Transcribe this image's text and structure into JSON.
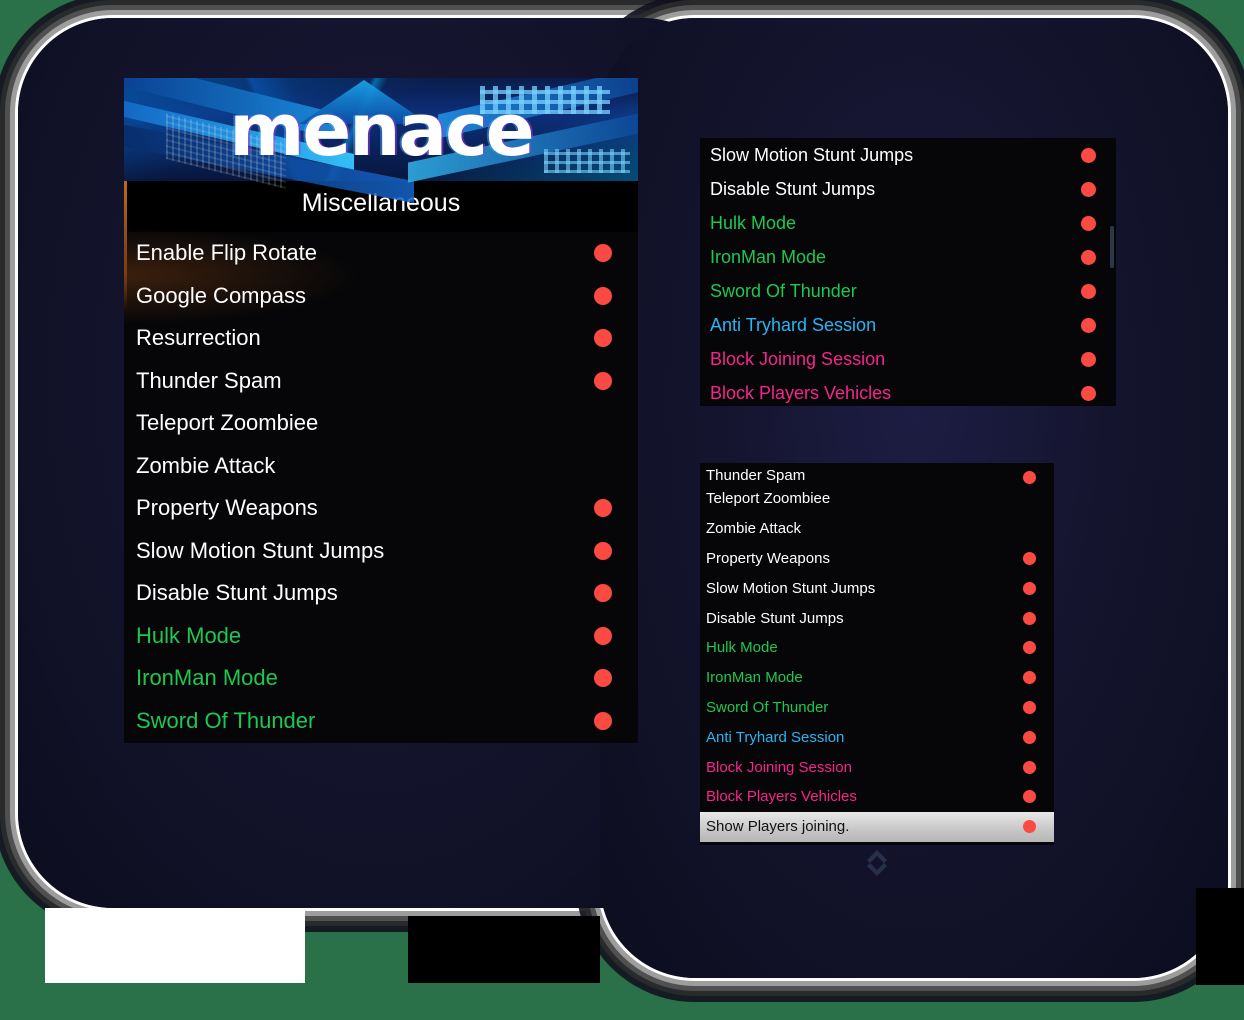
{
  "app": {
    "logo_text": "menace",
    "section_title": "Miscellaneous",
    "accent_red": "#fa4a42",
    "accent_green": "#1ec850",
    "accent_cyan": "#2ab4f5",
    "accent_pink": "#f5258c",
    "page_background": "#2a7049",
    "panel_background": "#060608"
  },
  "main_panel": {
    "items": [
      {
        "label": "Enable Flip Rotate",
        "color": "#ffffff",
        "toggle": true
      },
      {
        "label": "Google Compass",
        "color": "#ffffff",
        "toggle": true
      },
      {
        "label": "Resurrection",
        "color": "#ffffff",
        "toggle": true
      },
      {
        "label": "Thunder Spam",
        "color": "#ffffff",
        "toggle": true
      },
      {
        "label": "Teleport Zoombiee",
        "color": "#ffffff",
        "toggle": false
      },
      {
        "label": "Zombie Attack",
        "color": "#ffffff",
        "toggle": false
      },
      {
        "label": "Property Weapons",
        "color": "#ffffff",
        "toggle": true
      },
      {
        "label": "Slow Motion Stunt Jumps",
        "color": "#ffffff",
        "toggle": true
      },
      {
        "label": "Disable Stunt Jumps",
        "color": "#ffffff",
        "toggle": true
      },
      {
        "label": "Hulk Mode",
        "color": "#1ec850",
        "toggle": true
      },
      {
        "label": "IronMan Mode",
        "color": "#1ec850",
        "toggle": true
      },
      {
        "label": "Sword Of Thunder",
        "color": "#1ec850",
        "toggle": true
      }
    ]
  },
  "popup_top": {
    "items": [
      {
        "label": "Slow Motion Stunt Jumps",
        "color": "#ffffff",
        "toggle": true
      },
      {
        "label": "Disable Stunt Jumps",
        "color": "#ffffff",
        "toggle": true
      },
      {
        "label": "Hulk Mode",
        "color": "#1ec850",
        "toggle": true
      },
      {
        "label": "IronMan Mode",
        "color": "#1ec850",
        "toggle": true
      },
      {
        "label": "Sword Of Thunder",
        "color": "#1ec850",
        "toggle": true
      },
      {
        "label": "Anti Tryhard Session",
        "color": "#2ab4f5",
        "toggle": true
      },
      {
        "label": "Block Joining Session",
        "color": "#f5258c",
        "toggle": true
      },
      {
        "label": "Block Players Vehicles",
        "color": "#f5258c",
        "toggle": true
      }
    ]
  },
  "popup_bottom": {
    "items": [
      {
        "label": "Thunder Spam",
        "color": "#ffffff",
        "toggle": true,
        "clipped": true,
        "selected": false
      },
      {
        "label": "Teleport Zoombiee",
        "color": "#ffffff",
        "toggle": false,
        "clipped": false,
        "selected": false
      },
      {
        "label": "Zombie Attack",
        "color": "#ffffff",
        "toggle": false,
        "clipped": false,
        "selected": false
      },
      {
        "label": "Property Weapons",
        "color": "#ffffff",
        "toggle": true,
        "clipped": false,
        "selected": false
      },
      {
        "label": "Slow Motion Stunt Jumps",
        "color": "#ffffff",
        "toggle": true,
        "clipped": false,
        "selected": false
      },
      {
        "label": "Disable Stunt Jumps",
        "color": "#ffffff",
        "toggle": true,
        "clipped": false,
        "selected": false
      },
      {
        "label": "Hulk Mode",
        "color": "#1ec850",
        "toggle": true,
        "clipped": false,
        "selected": false
      },
      {
        "label": "IronMan Mode",
        "color": "#1ec850",
        "toggle": true,
        "clipped": false,
        "selected": false
      },
      {
        "label": "Sword Of Thunder",
        "color": "#1ec850",
        "toggle": true,
        "clipped": false,
        "selected": false
      },
      {
        "label": "Anti Tryhard Session",
        "color": "#2ab4f5",
        "toggle": true,
        "clipped": false,
        "selected": false
      },
      {
        "label": "Block Joining Session",
        "color": "#f5258c",
        "toggle": true,
        "clipped": false,
        "selected": false
      },
      {
        "label": "Block Players Vehicles",
        "color": "#f5258c",
        "toggle": true,
        "clipped": false,
        "selected": false
      },
      {
        "label": "Show Players joining.",
        "color": "#111111",
        "toggle": true,
        "clipped": false,
        "selected": true
      }
    ]
  }
}
